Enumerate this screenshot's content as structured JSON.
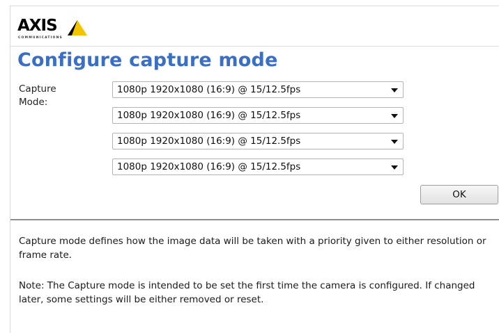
{
  "brand": {
    "name": "AXIS",
    "subtitle": "COMMUNICATIONS"
  },
  "page": {
    "title": "Configure capture mode"
  },
  "capture": {
    "label": "Capture\nMode:",
    "selects": [
      {
        "value": "1080p 1920x1080 (16:9) @ 15/12.5fps"
      },
      {
        "value": "1080p 1920x1080 (16:9) @ 15/12.5fps"
      },
      {
        "value": "1080p 1920x1080 (16:9) @ 15/12.5fps"
      },
      {
        "value": "1080p 1920x1080 (16:9) @ 15/12.5fps"
      }
    ],
    "ok_label": "OK"
  },
  "help": {
    "description": "Capture mode defines how the image data will be taken with a priority given to either resolution or frame rate.",
    "note": "Note: The Capture mode is intended to be set the first time the camera is configured. If changed later, some settings will be either removed or reset."
  },
  "colors": {
    "title": "#3a6fc4",
    "logo_triangle": "#f5c400",
    "logo_dark": "#000000"
  },
  "icons": {
    "dropdown": "chevron-down-icon",
    "logo": "axis-logo-triangle-icon"
  }
}
